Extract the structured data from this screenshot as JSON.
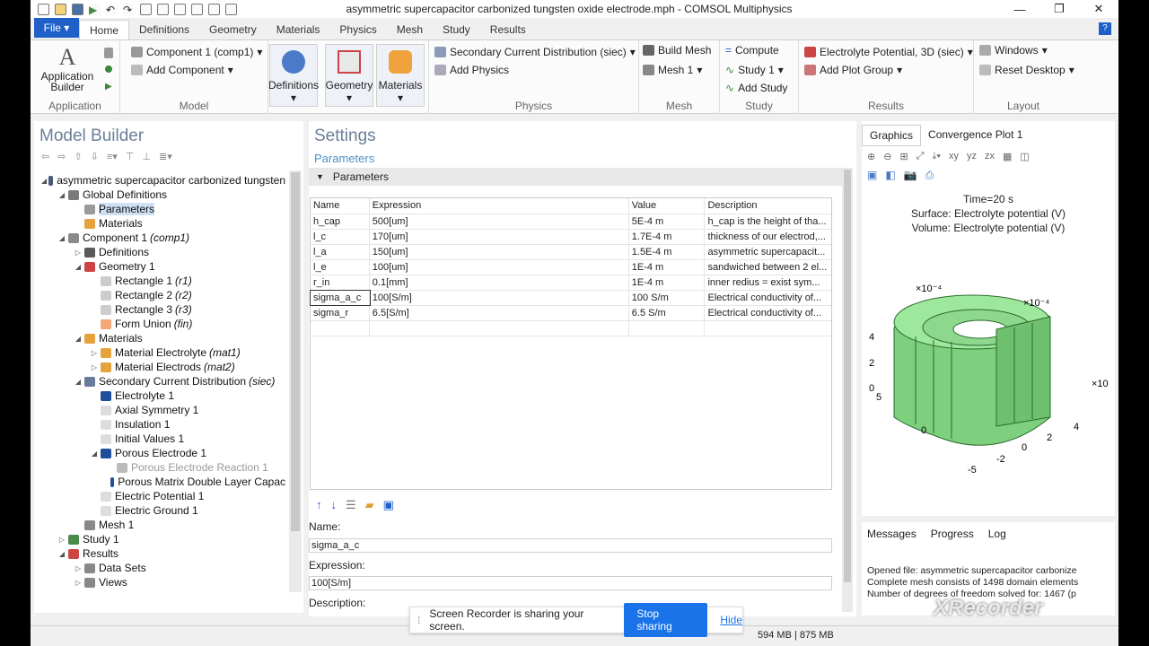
{
  "window": {
    "title": "asymmetric supercapacitor carbonized tungsten oxide electrode.mph - COMSOL Multiphysics"
  },
  "ribbon_tabs": {
    "file": "File ▾",
    "tabs": [
      "Home",
      "Definitions",
      "Geometry",
      "Materials",
      "Physics",
      "Mesh",
      "Study",
      "Results"
    ]
  },
  "ribbon": {
    "app_builder": "Application Builder",
    "component": "Component 1 (comp1)",
    "add_component": "Add Component",
    "definitions": "Definitions",
    "geometry": "Geometry",
    "materials": "Materials",
    "physics_interface": "Secondary Current Distribution (siec)",
    "add_physics": "Add Physics",
    "build_mesh": "Build Mesh",
    "mesh1": "Mesh 1",
    "compute": "Compute",
    "study1": "Study 1",
    "add_study": "Add Study",
    "plot": "Electrolyte Potential, 3D (siec)",
    "add_plot_group": "Add Plot Group",
    "windows": "Windows",
    "reset_desktop": "Reset Desktop",
    "groups": [
      "Application",
      "Model",
      "Physics",
      "Mesh",
      "Study",
      "Results",
      "Layout"
    ]
  },
  "model_builder": {
    "title": "Model Builder",
    "tree": [
      {
        "label": "asymmetric supercapacitor carbonized tungsten",
        "tag": "",
        "level": 0,
        "toggle": "◢",
        "color": "#4a5a7a"
      },
      {
        "label": "Global Definitions",
        "tag": "",
        "level": 1,
        "toggle": "◢",
        "color": "#7a7a7a"
      },
      {
        "label": "Parameters",
        "tag": "",
        "level": 2,
        "toggle": "",
        "color": "#9a9a9a",
        "selected": true
      },
      {
        "label": "Materials",
        "tag": "",
        "level": 2,
        "toggle": "",
        "color": "#e6a23c"
      },
      {
        "label": "Component 1",
        "tag": "(comp1)",
        "level": 1,
        "toggle": "◢",
        "color": "#8a8a8a"
      },
      {
        "label": "Definitions",
        "tag": "",
        "level": 2,
        "toggle": "▷",
        "color": "#5a5a5a"
      },
      {
        "label": "Geometry 1",
        "tag": "",
        "level": 2,
        "toggle": "◢",
        "color": "#c44"
      },
      {
        "label": "Rectangle 1",
        "tag": "(r1)",
        "level": 3,
        "toggle": "",
        "color": "#ccc"
      },
      {
        "label": "Rectangle 2",
        "tag": "(r2)",
        "level": 3,
        "toggle": "",
        "color": "#ccc"
      },
      {
        "label": "Rectangle 3",
        "tag": "(r3)",
        "level": 3,
        "toggle": "",
        "color": "#ccc"
      },
      {
        "label": "Form Union",
        "tag": "(fin)",
        "level": 3,
        "toggle": "",
        "color": "#f2a87a"
      },
      {
        "label": "Materials",
        "tag": "",
        "level": 2,
        "toggle": "◢",
        "color": "#e6a23c"
      },
      {
        "label": "Material Electrolyte",
        "tag": "(mat1)",
        "level": 3,
        "toggle": "▷",
        "color": "#e6a23c"
      },
      {
        "label": "Material Electrods",
        "tag": "(mat2)",
        "level": 3,
        "toggle": "▷",
        "color": "#e6a23c"
      },
      {
        "label": "Secondary Current Distribution",
        "tag": "(siec)",
        "level": 2,
        "toggle": "◢",
        "color": "#6a7a9a"
      },
      {
        "label": "Electrolyte 1",
        "tag": "",
        "level": 3,
        "toggle": "",
        "color": "#1f4f9a"
      },
      {
        "label": "Axial Symmetry 1",
        "tag": "",
        "level": 3,
        "toggle": "",
        "color": "#ddd"
      },
      {
        "label": "Insulation 1",
        "tag": "",
        "level": 3,
        "toggle": "",
        "color": "#ddd"
      },
      {
        "label": "Initial Values 1",
        "tag": "",
        "level": 3,
        "toggle": "",
        "color": "#ddd"
      },
      {
        "label": "Porous Electrode 1",
        "tag": "",
        "level": 3,
        "toggle": "◢",
        "color": "#1f4f9a"
      },
      {
        "label": "Porous Electrode Reaction 1",
        "tag": "",
        "level": 4,
        "toggle": "",
        "color": "#bbb",
        "dim": true
      },
      {
        "label": "Porous Matrix Double Layer Capac",
        "tag": "",
        "level": 4,
        "toggle": "",
        "color": "#1f4f9a"
      },
      {
        "label": "Electric Potential 1",
        "tag": "",
        "level": 3,
        "toggle": "",
        "color": "#ddd"
      },
      {
        "label": "Electric Ground 1",
        "tag": "",
        "level": 3,
        "toggle": "",
        "color": "#ddd"
      },
      {
        "label": "Mesh 1",
        "tag": "",
        "level": 2,
        "toggle": "",
        "color": "#888"
      },
      {
        "label": "Study 1",
        "tag": "",
        "level": 1,
        "toggle": "▷",
        "color": "#4a8a4a"
      },
      {
        "label": "Results",
        "tag": "",
        "level": 1,
        "toggle": "◢",
        "color": "#c44"
      },
      {
        "label": "Data Sets",
        "tag": "",
        "level": 2,
        "toggle": "▷",
        "color": "#888"
      },
      {
        "label": "Views",
        "tag": "",
        "level": 2,
        "toggle": "▷",
        "color": "#888"
      }
    ]
  },
  "settings": {
    "title": "Settings",
    "subtitle": "Parameters",
    "section": "Parameters",
    "columns": [
      "Name",
      "Expression",
      "Value",
      "Description"
    ],
    "rows": [
      [
        "h_cap",
        "500[um]",
        "5E-4 m",
        "h_cap is the height of tha..."
      ],
      [
        "l_c",
        "170[um]",
        "1.7E-4 m",
        "thickness of our electrod,..."
      ],
      [
        "l_a",
        "150[um]",
        "1.5E-4 m",
        "asymmetric supercapacit..."
      ],
      [
        "l_e",
        "100[um]",
        "1E-4 m",
        "sandwiched between 2 el..."
      ],
      [
        "r_in",
        "0.1[mm]",
        "1E-4 m",
        "inner redius = exist sym..."
      ],
      [
        "sigma_a_c",
        "100[S/m]",
        "100 S/m",
        "Electrical conductivity of..."
      ],
      [
        "sigma_r",
        "6.5[S/m]",
        "6.5 S/m",
        "Electrical conductivity of..."
      ],
      [
        "",
        "",
        "",
        ""
      ]
    ],
    "name_label": "Name:",
    "name_value": "sigma_a_c",
    "expression_label": "Expression:",
    "expression_value": "100[S/m]",
    "description_label": "Description:"
  },
  "graphics": {
    "tabs": [
      "Graphics",
      "Convergence Plot 1"
    ],
    "time": "Time=20 s",
    "surface": "Surface: Electrolyte potential (V)",
    "volume": "Volume: Electrolyte potential (V)",
    "axis_labels": [
      "×10⁻⁴",
      "×10⁻⁴",
      "×10",
      "4",
      "2",
      "0",
      "5",
      "0",
      "-5",
      "-2",
      "0",
      "2",
      "4"
    ]
  },
  "messages": {
    "tabs": [
      "Messages",
      "Progress",
      "Log"
    ],
    "lines": [
      "Opened file: asymmetric supercapacitor carbonize",
      "Complete mesh consists of 1498 domain elements",
      "Number of degrees of freedom solved for: 1467 (p"
    ]
  },
  "status": {
    "memory": "594 MB | 875 MB"
  },
  "screen_share": {
    "message": "Screen Recorder is sharing your screen.",
    "stop": "Stop sharing",
    "hide": "Hide"
  },
  "watermark": "XRecorder"
}
